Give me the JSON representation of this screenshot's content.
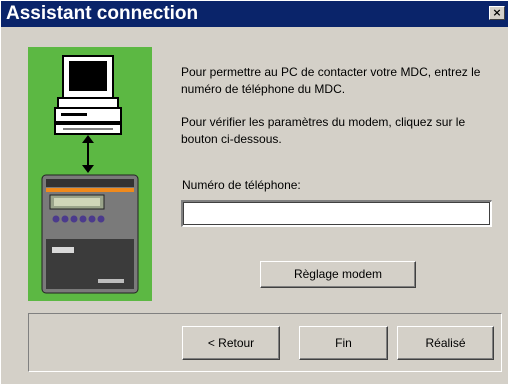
{
  "window": {
    "title": "Assistant connection",
    "close_label": "×"
  },
  "content": {
    "info_connect": "Pour permettre au PC de contacter votre MDC, entrez le numéro de téléphone du MDC.",
    "info_modem": "Pour vérifier les paramètres du modem, cliquez sur le bouton ci-dessous.",
    "phone_label": "Numéro de téléphone:",
    "phone_value": "",
    "modem_button": "Règlage modem"
  },
  "illustration": {
    "icon": "pc-to-controller-icon",
    "background_color": "#5cb843"
  },
  "footer": {
    "back_button": "< Retour",
    "finish_button": "Fin",
    "done_button": "Réalisé"
  }
}
